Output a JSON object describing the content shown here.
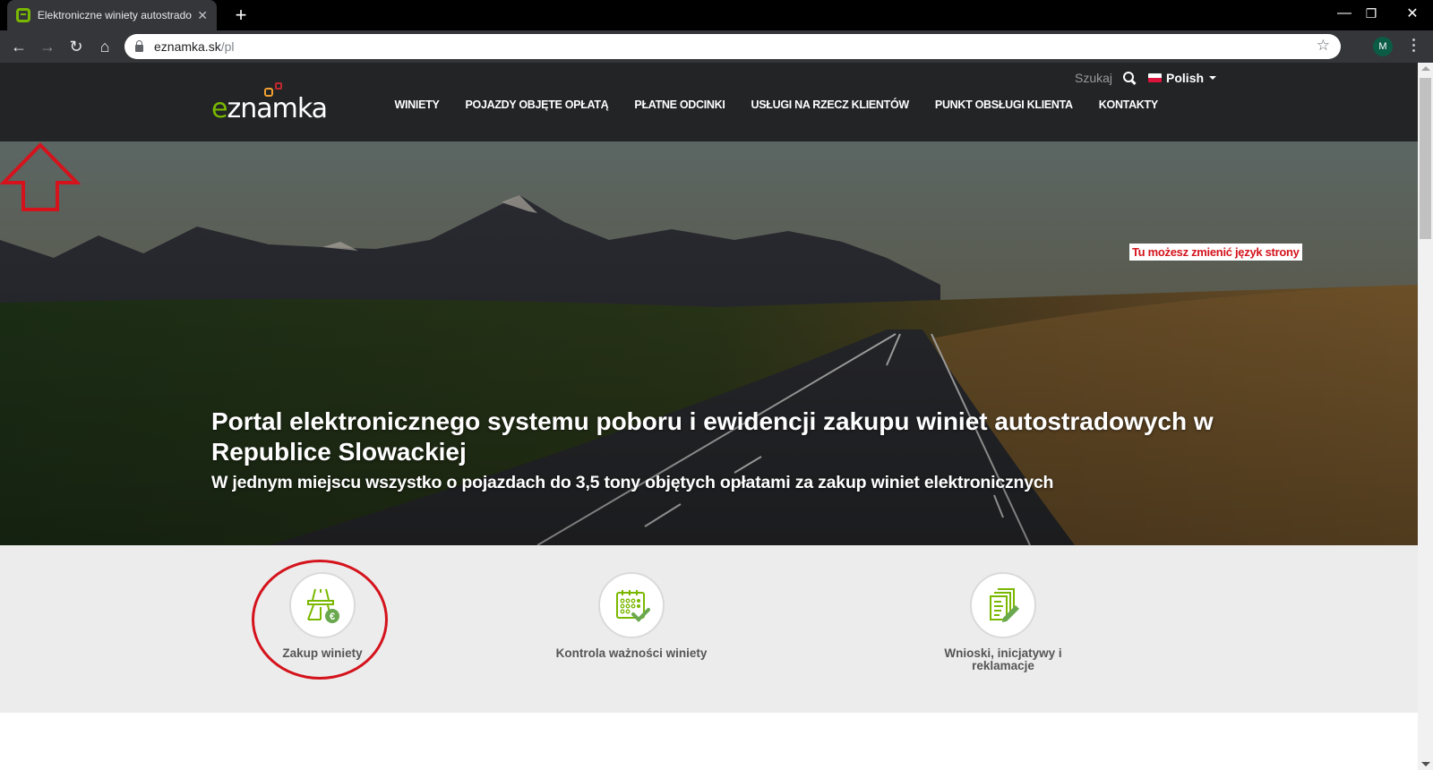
{
  "browser": {
    "tab_title": "Elektroniczne winiety autostradowe",
    "tab_close": "✕",
    "new_tab": "+",
    "url_host": "eznamka.sk",
    "url_path": "/pl",
    "avatar_initial": "M",
    "window_controls": {
      "minimize": "—",
      "restore": "❐",
      "close": "✕"
    }
  },
  "header": {
    "logo_e": "e",
    "logo_rest": "znamka",
    "nav": [
      "WINIETY",
      "POJAZDY OBJĘTE OPŁATĄ",
      "PŁATNE ODCINKI",
      "USŁUGI NA RZECZ KLIENTÓW",
      "PUNKT OBSŁUGI KLIENTA",
      "KONTAKTY"
    ],
    "search_label": "Szukaj",
    "language": "Polish"
  },
  "hero": {
    "title": "Portal elektronicznego systemu poboru i ewidencji zakupu winiet autostradowych w Republice Slowackiej",
    "subtitle": "W jednym miejscu wszystko o pojazdach do 3,5 tony objętych opłatami za zakup winiet elektronicznych"
  },
  "annotation": {
    "label": "Tu możesz zmienić język strony",
    "color": "#d4131c"
  },
  "services": [
    {
      "label": "Zakup winiety",
      "icon": "highway-euro-icon"
    },
    {
      "label": "Kontrola ważności winiety",
      "icon": "calendar-check-icon"
    },
    {
      "label": "Wnioski, inicjatywy i reklamacje",
      "icon": "documents-pen-icon"
    }
  ],
  "colors": {
    "brand_green": "#7ab800",
    "header_bg": "#222426",
    "annotation_red": "#d4131c"
  }
}
